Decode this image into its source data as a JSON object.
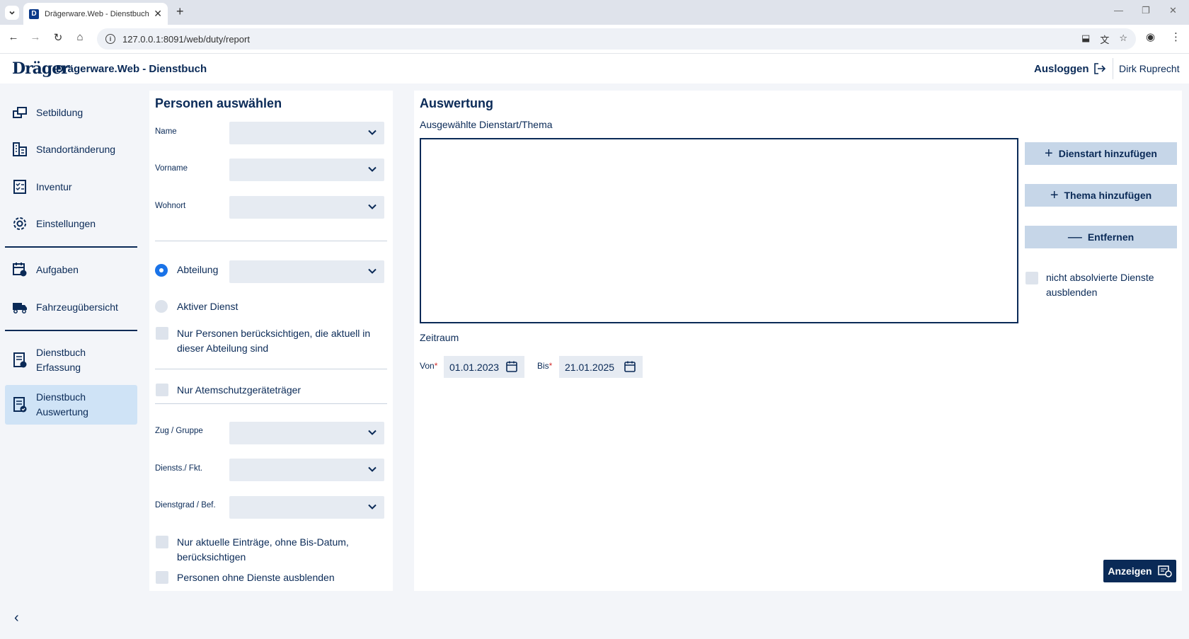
{
  "browser": {
    "tab_title": "Drägerware.Web - Dienstbuch",
    "url": "127.0.0.1:8091/web/duty/report"
  },
  "header": {
    "logo": "Dräger",
    "app_title": "Drägerware.Web - Dienstbuch",
    "logout_label": "Ausloggen",
    "user_name": "Dirk Ruprecht"
  },
  "sidebar": {
    "items": [
      {
        "label": "Setbildung",
        "icon": "set-icon"
      },
      {
        "label": "Standortänderung",
        "icon": "building-icon"
      },
      {
        "label": "Inventur",
        "icon": "checklist-icon"
      },
      {
        "label": "Einstellungen",
        "icon": "gear-icon"
      },
      {
        "label": "Aufgaben",
        "icon": "calendar-task-icon"
      },
      {
        "label": "Fahrzeugübersicht",
        "icon": "truck-icon"
      },
      {
        "label": "Dienstbuch Erfassung",
        "icon": "book-edit-icon"
      },
      {
        "label": "Dienstbuch Auswertung",
        "icon": "book-check-icon",
        "active": true
      }
    ]
  },
  "persons": {
    "title": "Personen auswählen",
    "name_label": "Name",
    "vorname_label": "Vorname",
    "wohnort_label": "Wohnort",
    "abteilung_label": "Abteilung",
    "aktiver_dienst_label": "Aktiver Dienst",
    "nur_abteilung_label": "Nur Personen berücksichtigen, die aktuell in dieser Abteilung sind",
    "atemschutz_label": "Nur Atemschutzgeräteträger",
    "zug_label": "Zug / Gruppe",
    "diensts_label": "Diensts./ Fkt.",
    "dienstgrad_label": "Dienstgrad / Bef.",
    "aktuelle_label": "Nur aktuelle Einträge, ohne Bis-Datum, berücksichtigen",
    "ohne_dienste_label": "Personen ohne Dienste ausblenden"
  },
  "report": {
    "title": "Auswertung",
    "selected_label": "Ausgewählte Dienstart/Thema",
    "add_dienstart": "Dienstart hinzufügen",
    "add_thema": "Thema hinzufügen",
    "remove": "Entfernen",
    "hide_not_completed": "nicht absolvierte Dienste ausblenden",
    "zeitraum_label": "Zeitraum",
    "von_label": "Von",
    "von_value": "01.01.2023",
    "bis_label": "Bis",
    "bis_value": "21.01.2025",
    "show_button": "Anzeigen"
  },
  "colors": {
    "primary": "#0a2a57",
    "active_nav": "#cfe3f6",
    "field_bg": "#e6ebf2",
    "secondary_button": "#c6d6e8",
    "radio_on": "#1a73e8",
    "required": "#d32f2f"
  }
}
